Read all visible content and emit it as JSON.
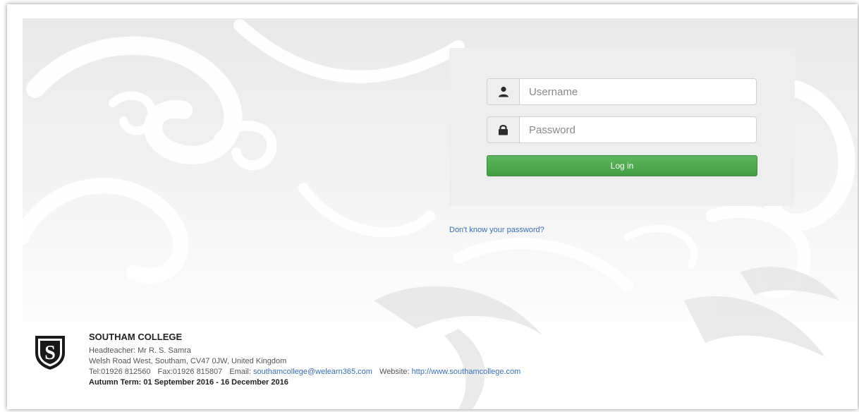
{
  "login": {
    "username_placeholder": "Username",
    "password_placeholder": "Password",
    "login_label": "Log in",
    "forgot_password": "Don't know your password?"
  },
  "icons": {
    "username": "user-icon",
    "password": "lock-icon",
    "crest": "school-crest-icon"
  },
  "school": {
    "crest_letter": "S",
    "name": "SOUTHAM COLLEGE",
    "headteacher": "Headteacher: Mr R. S. Samra",
    "address": "Welsh Road West, Southam, CV47 0JW, United Kingdom",
    "tel": "Tel:01926 812560",
    "fax": "Fax:01926 815807",
    "email_label": "Email:",
    "email": "southamcollege@welearn365.com",
    "website_label": "Website:",
    "website": "http://www.southamcollege.com",
    "term": "Autumn Term: 01 September 2016 - 16 December 2016"
  },
  "colors": {
    "button_green": "#5cb85c",
    "link_blue": "#3a6fb5",
    "panel_grey": "#eeeeee"
  }
}
